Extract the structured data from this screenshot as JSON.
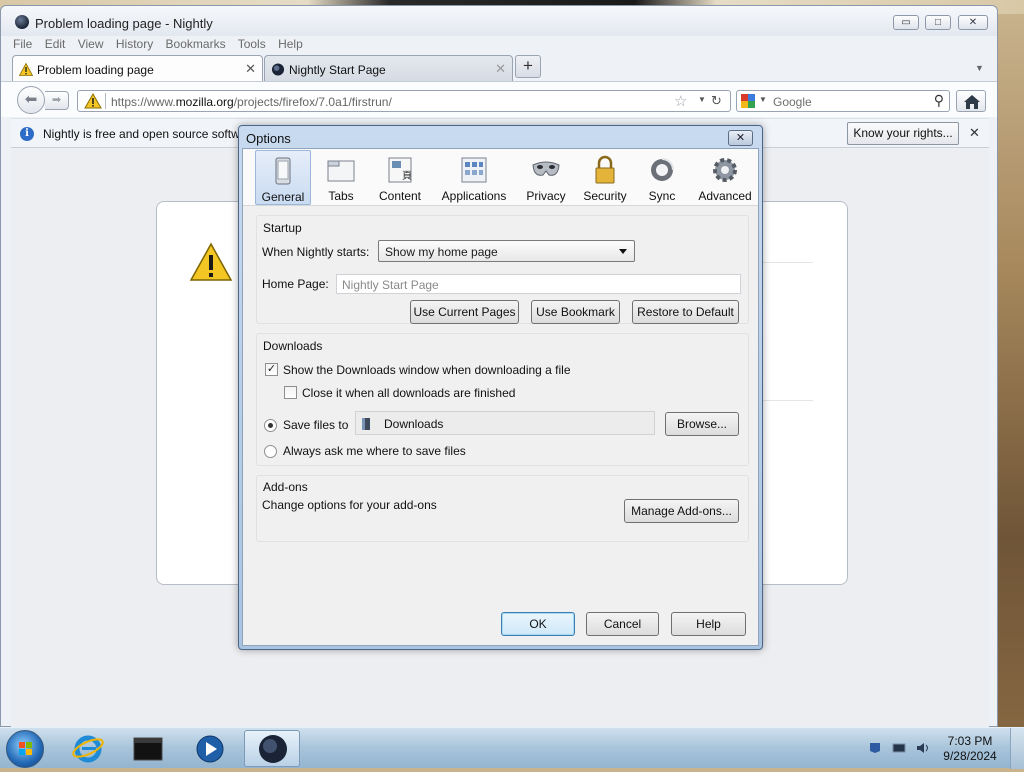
{
  "window": {
    "title": "Problem loading page - Nightly",
    "controls": {
      "minimize": "▭",
      "maximize": "□",
      "close": "✕"
    }
  },
  "menu": [
    "File",
    "Edit",
    "View",
    "History",
    "Bookmarks",
    "Tools",
    "Help"
  ],
  "tabs": [
    {
      "label": "Problem loading page",
      "icon": "warning-icon",
      "active": true
    },
    {
      "label": "Nightly Start Page",
      "icon": "nightly-logo-icon",
      "active": false
    }
  ],
  "newtab_label": "+",
  "navbar": {
    "url_prefix": "https://www.",
    "url_domain": "mozilla.org",
    "url_path": "/projects/firefox/7.0a1/firstrun/",
    "search_placeholder": "Google"
  },
  "notification": {
    "text": "Nightly is free and open source software",
    "button": "Know your rights..."
  },
  "dialog": {
    "title": "Options",
    "panes": [
      "General",
      "Tabs",
      "Content",
      "Applications",
      "Privacy",
      "Security",
      "Sync",
      "Advanced"
    ],
    "selected_pane": "General",
    "startup": {
      "group_title": "Startup",
      "when_starts_label": "When Nightly starts:",
      "when_starts_value": "Show my home page",
      "homepage_label": "Home Page:",
      "homepage_placeholder": "Nightly Start Page",
      "buttons": [
        "Use Current Pages",
        "Use Bookmark",
        "Restore to Default"
      ]
    },
    "downloads": {
      "group_title": "Downloads",
      "show_window_label": "Show the Downloads window when downloading a file",
      "show_window_checked": true,
      "close_when_done_label": "Close it when all downloads are finished",
      "close_when_done_checked": false,
      "save_files_label": "Save files to",
      "save_folder": "Downloads",
      "browse_button": "Browse...",
      "always_ask_label": "Always ask me where to save files",
      "selected_option": "save_files"
    },
    "addons": {
      "group_title": "Add-ons",
      "description": "Change options for your add-ons",
      "manage_button": "Manage Add-ons..."
    },
    "footer": {
      "ok": "OK",
      "cancel": "Cancel",
      "help": "Help"
    }
  },
  "taskbar": {
    "time": "7:03 PM",
    "date": "9/28/2024",
    "pinned": [
      "internet-explorer-icon",
      "terminal-icon",
      "media-player-icon",
      "nightly-browser-icon"
    ]
  }
}
